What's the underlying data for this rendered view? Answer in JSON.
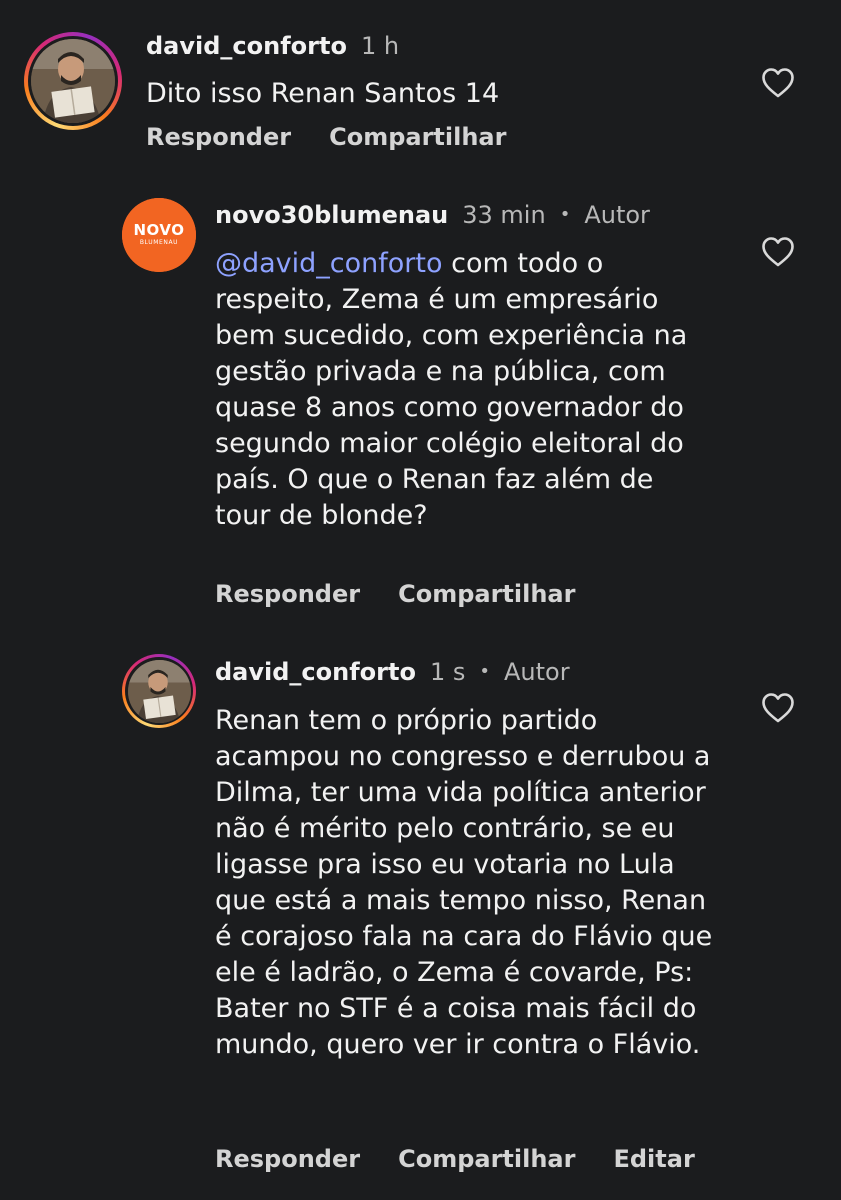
{
  "comments": [
    {
      "username": "david_conforto",
      "time": "1 h",
      "author_tag": "",
      "mention": "",
      "text": "Dito isso Renan Santos 14",
      "actions": {
        "reply": "Responder",
        "share": "Compartilhar",
        "edit": ""
      }
    },
    {
      "username": "novo30blumenau",
      "time": "33 min",
      "author_tag": "Autor",
      "mention": "@david_conforto",
      "text": " com todo o respeito, Zema é um empresário bem sucedido, com experiência na gestão privada e na pública, com quase 8 anos como governador do segundo maior colégio eleitoral do país. O que o Renan faz além de tour de blonde?",
      "avatar_logo": {
        "word": "NOVO",
        "sub": "BLUMENAU"
      },
      "actions": {
        "reply": "Responder",
        "share": "Compartilhar",
        "edit": ""
      }
    },
    {
      "username": "david_conforto",
      "time": "1 s",
      "author_tag": "Autor",
      "mention": "",
      "text": "Renan tem o próprio partido acampou no congresso e derrubou a Dilma, ter uma vida política anterior não é mérito pelo contrário, se eu ligasse pra isso eu votaria no Lula que está a mais tempo nisso, Renan é corajoso fala na cara do Flávio que ele é ladrão, o Zema é covarde, Ps: Bater no STF é a coisa mais fácil do mundo, quero ver ir contra o Flávio.",
      "actions": {
        "reply": "Responder",
        "share": "Compartilhar",
        "edit": "Editar"
      }
    }
  ],
  "dot_separator": "•",
  "colors": {
    "background": "#1b1c1e",
    "mention": "#8ea2ff",
    "novo_orange": "#f26522"
  },
  "icons": {
    "like": "heart-outline-icon"
  }
}
